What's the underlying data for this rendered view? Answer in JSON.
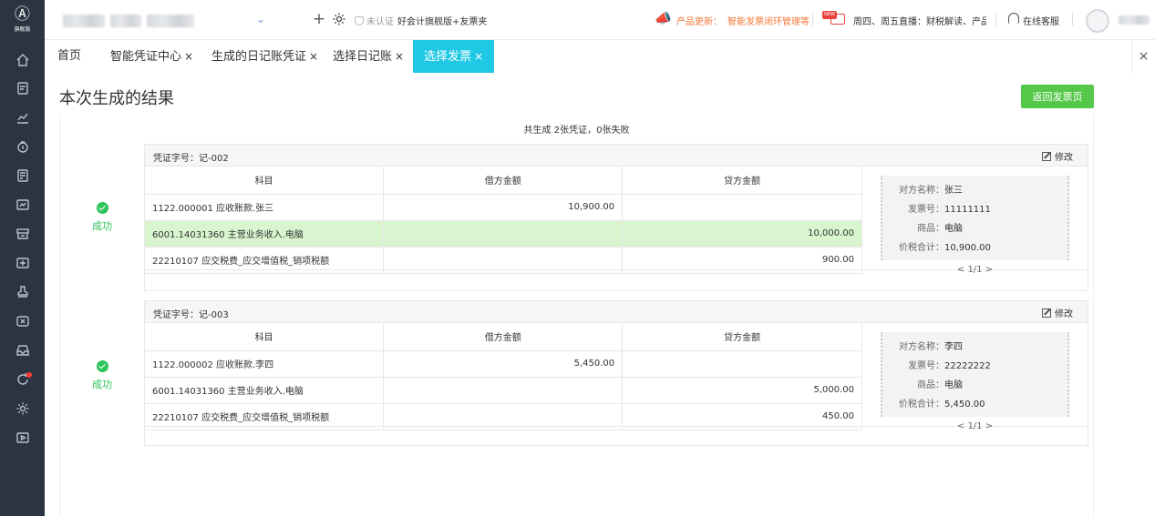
{
  "sidebar": {
    "logo_glyph": "Ⓐ",
    "logo_text": "旗舰版",
    "icons": [
      "home-icon",
      "ledger-icon",
      "chart-icon",
      "tax-icon",
      "invoice-icon",
      "report-icon",
      "archive-icon",
      "asset-icon",
      "stamp-icon",
      "voucher-icon",
      "inbox-icon",
      "update-icon",
      "settings-icon",
      "video-icon"
    ]
  },
  "header": {
    "plus": "+",
    "cert_status": "未认证",
    "edition": "好会计旗舰版+友票夹",
    "update_label": "产品更新：",
    "update_text": "智能发票闭环管理等",
    "new_badge": "NEW",
    "live_text": "周四、周五直播：财税解读、产品",
    "support": "在线客服"
  },
  "tabs": [
    {
      "label": "首页",
      "closable": false
    },
    {
      "label": "智能凭证中心",
      "closable": true
    },
    {
      "label": "生成的日记账凭证",
      "closable": true
    },
    {
      "label": "选择日记账",
      "closable": true
    },
    {
      "label": "选择发票",
      "closable": true,
      "active": true
    }
  ],
  "tab_close_symbol": "×",
  "page": {
    "title": "本次生成的结果",
    "back_button": "返回发票页",
    "summary": "共生成 2张凭证，0张失败"
  },
  "columns": {
    "subject": "科目",
    "debit": "借方金额",
    "credit": "贷方金额"
  },
  "labels": {
    "voucher_no_prefix": "凭证字号：",
    "edit": "修改",
    "success": "成功",
    "counterparty": "对方名称：",
    "invoice_no": "发票号：",
    "goods": "商品：",
    "total": "价税合计："
  },
  "vouchers": [
    {
      "no": "记-002",
      "status": "成功",
      "entries": [
        {
          "subject": "1122.000001 应收账款.张三",
          "debit": "10,900.00",
          "credit": ""
        },
        {
          "subject": "6001.14031360 主营业务收入.电脑",
          "debit": "",
          "credit": "10,000.00"
        },
        {
          "subject": "22210107 应交税费_应交增值税_销项税额",
          "debit": "",
          "credit": "900.00"
        }
      ],
      "invoice": {
        "counterparty": "张三",
        "invoice_no": "11111111",
        "goods": "电脑",
        "total": "10,900.00",
        "pager": "< 1/1 >"
      }
    },
    {
      "no": "记-003",
      "status": "成功",
      "entries": [
        {
          "subject": "1122.000002 应收账款.李四",
          "debit": "5,450.00",
          "credit": ""
        },
        {
          "subject": "6001.14031360 主营业务收入.电脑",
          "debit": "",
          "credit": "5,000.00"
        },
        {
          "subject": "22210107 应交税费_应交增值税_销项税额",
          "debit": "",
          "credit": "450.00"
        }
      ],
      "invoice": {
        "counterparty": "李四",
        "invoice_no": "22222222",
        "goods": "电脑",
        "total": "5,450.00",
        "pager": "< 1/1 >"
      }
    }
  ],
  "colors": {
    "accent": "#1fc8e4",
    "success": "#2ec35b",
    "primary_button": "#55c84a",
    "warning": "#f5793a",
    "sidebar": "#2b3442",
    "highlight_row": "#d8f5cf"
  }
}
